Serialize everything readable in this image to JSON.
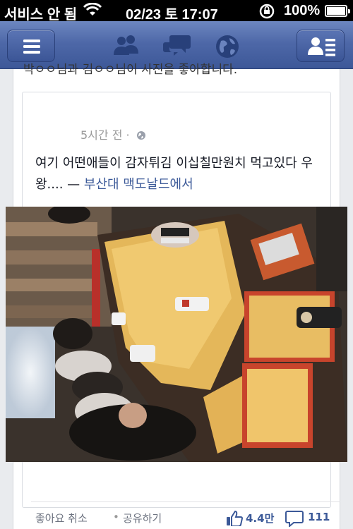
{
  "status_bar": {
    "carrier": "서비스 안 됨",
    "datetime": "02/23 토 17:07",
    "battery_percent": "100%",
    "battery_level": 1.0
  },
  "nav_bar": {
    "icons": [
      "menu-icon",
      "friend-requests-icon",
      "messages-icon",
      "notifications-globe-icon",
      "friends-list-icon"
    ]
  },
  "feed": {
    "previous_caption": "박ㅇㅇ님과 김ㅇㅇ님이 사진을 좋아합니다.",
    "shared_post": {
      "time": "5시간 전 ·",
      "text": "여기 어떤애들이 감자튀김 이십칠만원치 먹고있다 우왕....",
      "place_prefix": " — ",
      "place": "부산대 맥도날드에서",
      "photo_alt": "Trays of french fries on a long table with people eating"
    },
    "actions": {
      "unlike": "좋아요 취소",
      "separator": "•",
      "share": "공유하기",
      "like_count": "4.4만",
      "comment_count": "111"
    }
  },
  "colors": {
    "nav_blue": "#4e68a8",
    "link_blue": "#3b5998"
  }
}
